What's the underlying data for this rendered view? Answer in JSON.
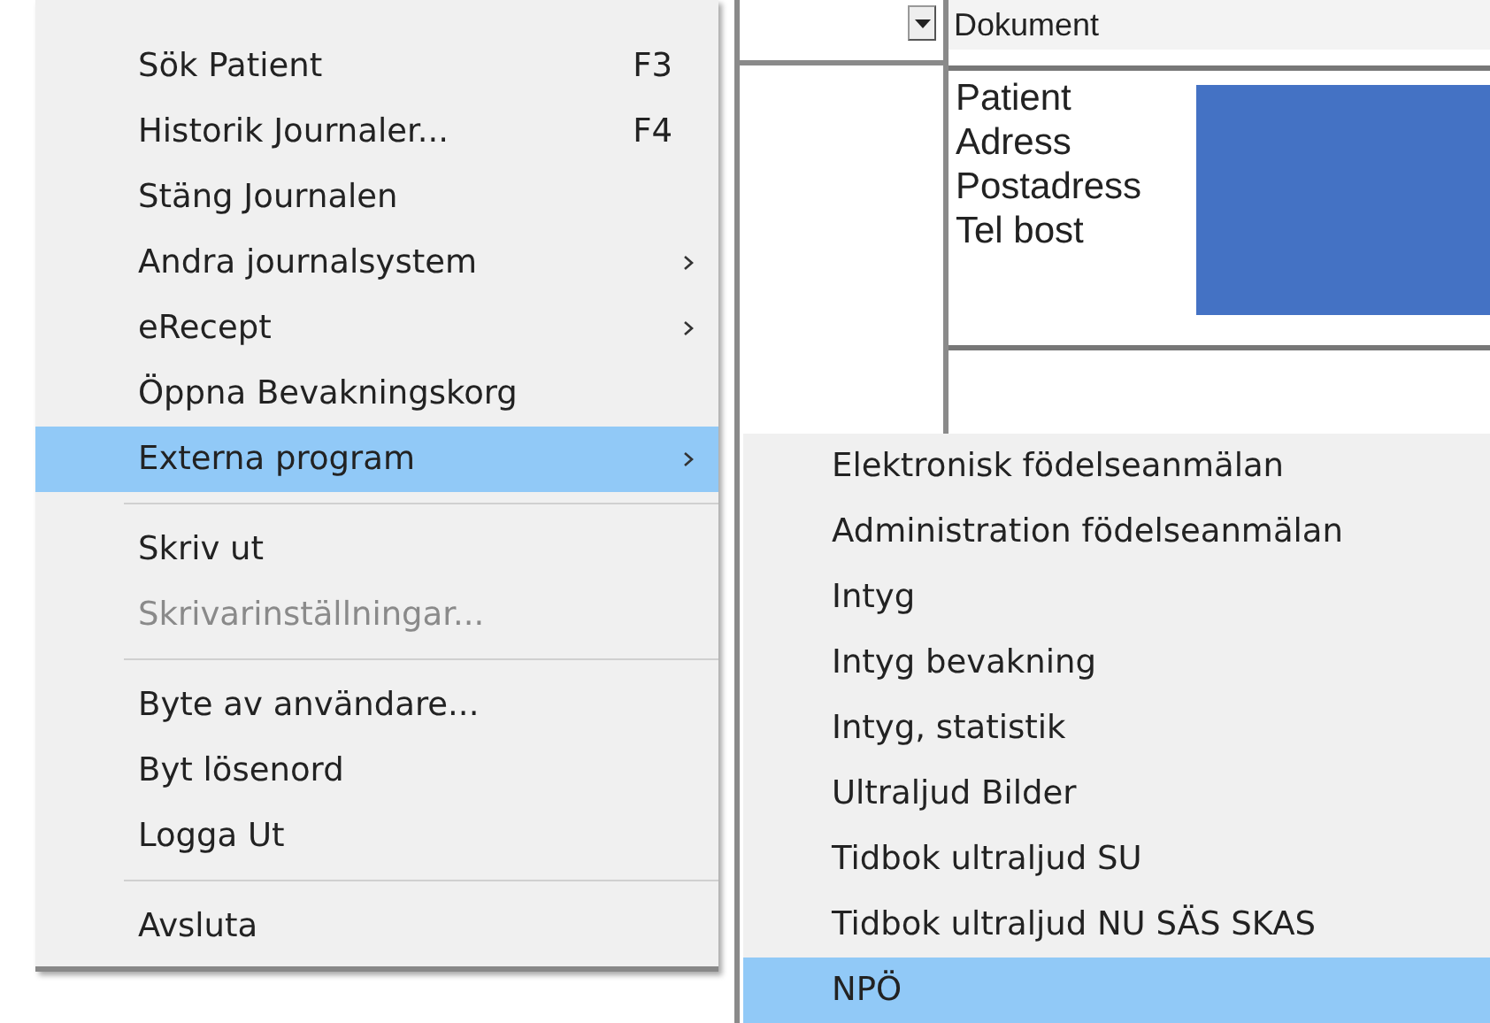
{
  "document_window": {
    "document_field": "Dokument",
    "patient_labels": [
      "Patient",
      "Adress",
      "Postadress",
      "Tel bost"
    ]
  },
  "menu": {
    "items": [
      {
        "kind": "item",
        "label": "Sök Patient",
        "shortcut": "F3",
        "submenu": false,
        "disabled": false,
        "selected": false
      },
      {
        "kind": "item",
        "label": "Historik Journaler...",
        "shortcut": "F4",
        "submenu": false,
        "disabled": false,
        "selected": false
      },
      {
        "kind": "item",
        "label": "Stäng Journalen",
        "submenu": false,
        "disabled": false,
        "selected": false
      },
      {
        "kind": "item",
        "label": "Andra journalsystem",
        "submenu": true,
        "disabled": false,
        "selected": false
      },
      {
        "kind": "item",
        "label": "eRecept",
        "submenu": true,
        "disabled": false,
        "selected": false
      },
      {
        "kind": "item",
        "label": "Öppna Bevakningskorg",
        "submenu": false,
        "disabled": false,
        "selected": false
      },
      {
        "kind": "item",
        "label": "Externa program",
        "submenu": true,
        "disabled": false,
        "selected": true
      },
      {
        "kind": "separator"
      },
      {
        "kind": "item",
        "label": "Skriv ut",
        "submenu": false,
        "disabled": false,
        "selected": false
      },
      {
        "kind": "item",
        "label": "Skrivarinställningar...",
        "submenu": false,
        "disabled": true,
        "selected": false
      },
      {
        "kind": "separator"
      },
      {
        "kind": "item",
        "label": "Byte av användare...",
        "submenu": false,
        "disabled": false,
        "selected": false
      },
      {
        "kind": "item",
        "label": "Byt lösenord",
        "submenu": false,
        "disabled": false,
        "selected": false
      },
      {
        "kind": "item",
        "label": "Logga Ut",
        "submenu": false,
        "disabled": false,
        "selected": false
      },
      {
        "kind": "separator"
      },
      {
        "kind": "item",
        "label": "Avsluta",
        "submenu": false,
        "disabled": false,
        "selected": false
      }
    ]
  },
  "submenu": {
    "items": [
      {
        "label": "Elektronisk födelseanmälan",
        "selected": false
      },
      {
        "label": "Administration födelseanmälan",
        "selected": false
      },
      {
        "label": "Intyg",
        "selected": false
      },
      {
        "label": "Intyg bevakning",
        "selected": false
      },
      {
        "label": "Intyg, statistik",
        "selected": false
      },
      {
        "label": "Ultraljud Bilder",
        "selected": false
      },
      {
        "label": "Tidbok ultraljud SU",
        "selected": false
      },
      {
        "label": "Tidbok ultraljud NU SÄS SKAS",
        "selected": false
      },
      {
        "label": "NPÖ",
        "selected": true
      }
    ]
  }
}
